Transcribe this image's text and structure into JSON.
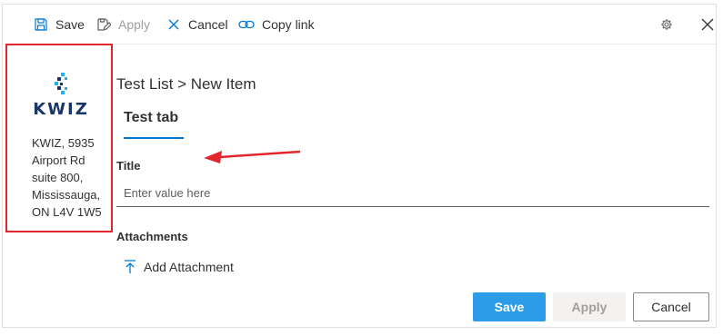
{
  "toolbar": {
    "save_label": "Save",
    "apply_label": "Apply",
    "cancel_label": "Cancel",
    "copy_link_label": "Copy link",
    "icons": [
      "save-icon",
      "apply-icon",
      "cancel-icon",
      "link-icon",
      "gear-icon",
      "close-icon"
    ]
  },
  "company": {
    "logo_text": "KWIZ",
    "address_lines": [
      "KWIZ, 5935",
      "Airport Rd",
      "suite 800,",
      "Mississauga,",
      "ON L4V 1W5"
    ]
  },
  "form": {
    "breadcrumb": "Test List > New Item",
    "tab_label": "Test tab",
    "title_label": "Title",
    "title_placeholder": "Enter value here",
    "title_value": "",
    "attachments_label": "Attachments",
    "add_attachment_label": "Add Attachment"
  },
  "footer": {
    "save_label": "Save",
    "apply_label": "Apply",
    "cancel_label": "Cancel"
  },
  "colors": {
    "accent": "#0078d4",
    "primary_button": "#2d9ce8",
    "highlight_border": "#e3262e",
    "logo_navy": "#1a3567",
    "logo_cyan": "#1fb5e8"
  }
}
